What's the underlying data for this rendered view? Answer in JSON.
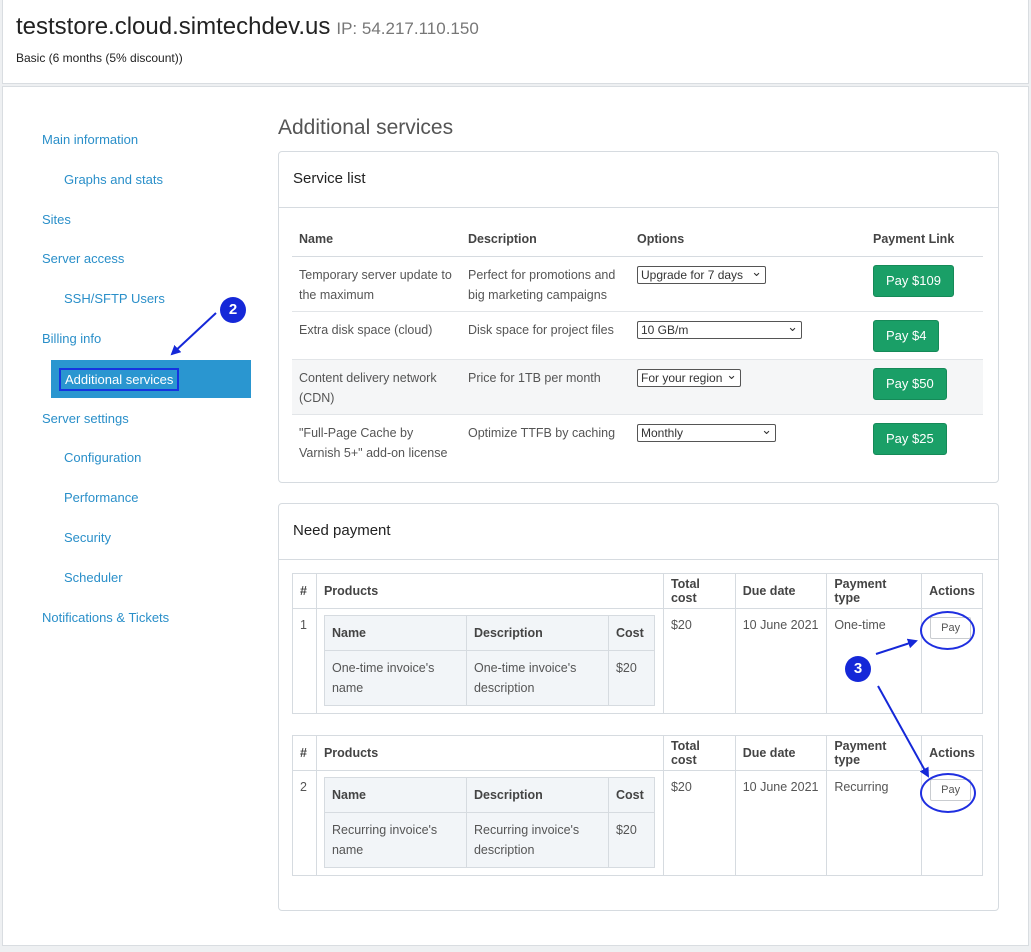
{
  "header": {
    "host": "teststore.cloud.simtechdev.us",
    "ip_label": "IP: 54.217.110.150",
    "plan": "Basic (6 months (5% discount))"
  },
  "sidebar": {
    "items": [
      {
        "label": "Main information"
      },
      {
        "label": "Graphs and stats"
      },
      {
        "label": "Sites"
      },
      {
        "label": "Server access"
      },
      {
        "label": "SSH/SFTP Users"
      },
      {
        "label": "Billing info"
      },
      {
        "label": "Additional services"
      },
      {
        "label": "Server settings"
      },
      {
        "label": "Configuration"
      },
      {
        "label": "Performance"
      },
      {
        "label": "Security"
      },
      {
        "label": "Scheduler"
      },
      {
        "label": "Notifications & Tickets"
      }
    ],
    "active_item": "Additional services"
  },
  "page_title": "Additional services",
  "service_list": {
    "title": "Service list",
    "columns": [
      "Name",
      "Description",
      "Options",
      "Payment Link"
    ],
    "rows": [
      {
        "name": "Temporary server update to the maximum",
        "description": "Perfect for promotions and big marketing campaigns",
        "option": "Upgrade for 7 days",
        "pay": "Pay $109"
      },
      {
        "name": "Extra disk space (cloud)",
        "description": "Disk space for project files",
        "option": "10 GB/m",
        "pay": "Pay $4"
      },
      {
        "name": "Content delivery network (CDN)",
        "description": "Price for 1TB per month",
        "option": "For your region",
        "pay": "Pay $50"
      },
      {
        "name": "\"Full-Page Cache by Varnish 5+\" add-on license",
        "description": "Optimize TTFB by caching",
        "option": "Monthly",
        "pay": "Pay $25"
      }
    ]
  },
  "need_payment": {
    "title": "Need payment",
    "columns": [
      "#",
      "Products",
      "Total cost",
      "Due date",
      "Payment type",
      "Actions"
    ],
    "sub_columns": [
      "Name",
      "Description",
      "Cost"
    ],
    "invoices": [
      {
        "num": "1",
        "product_name": "One-time invoice's name",
        "product_desc": "One-time invoice's description",
        "cost": "$20",
        "total": "$20",
        "due": "10 June 2021",
        "type": "One-time",
        "action": "Pay"
      },
      {
        "num": "2",
        "product_name": "Recurring invoice's name",
        "product_desc": "Recurring invoice's description",
        "cost": "$20",
        "total": "$20",
        "due": "10 June 2021",
        "type": "Recurring",
        "action": "Pay"
      }
    ]
  },
  "annotations": {
    "marker_2": "2",
    "marker_3": "3",
    "color": "#1528d8"
  }
}
